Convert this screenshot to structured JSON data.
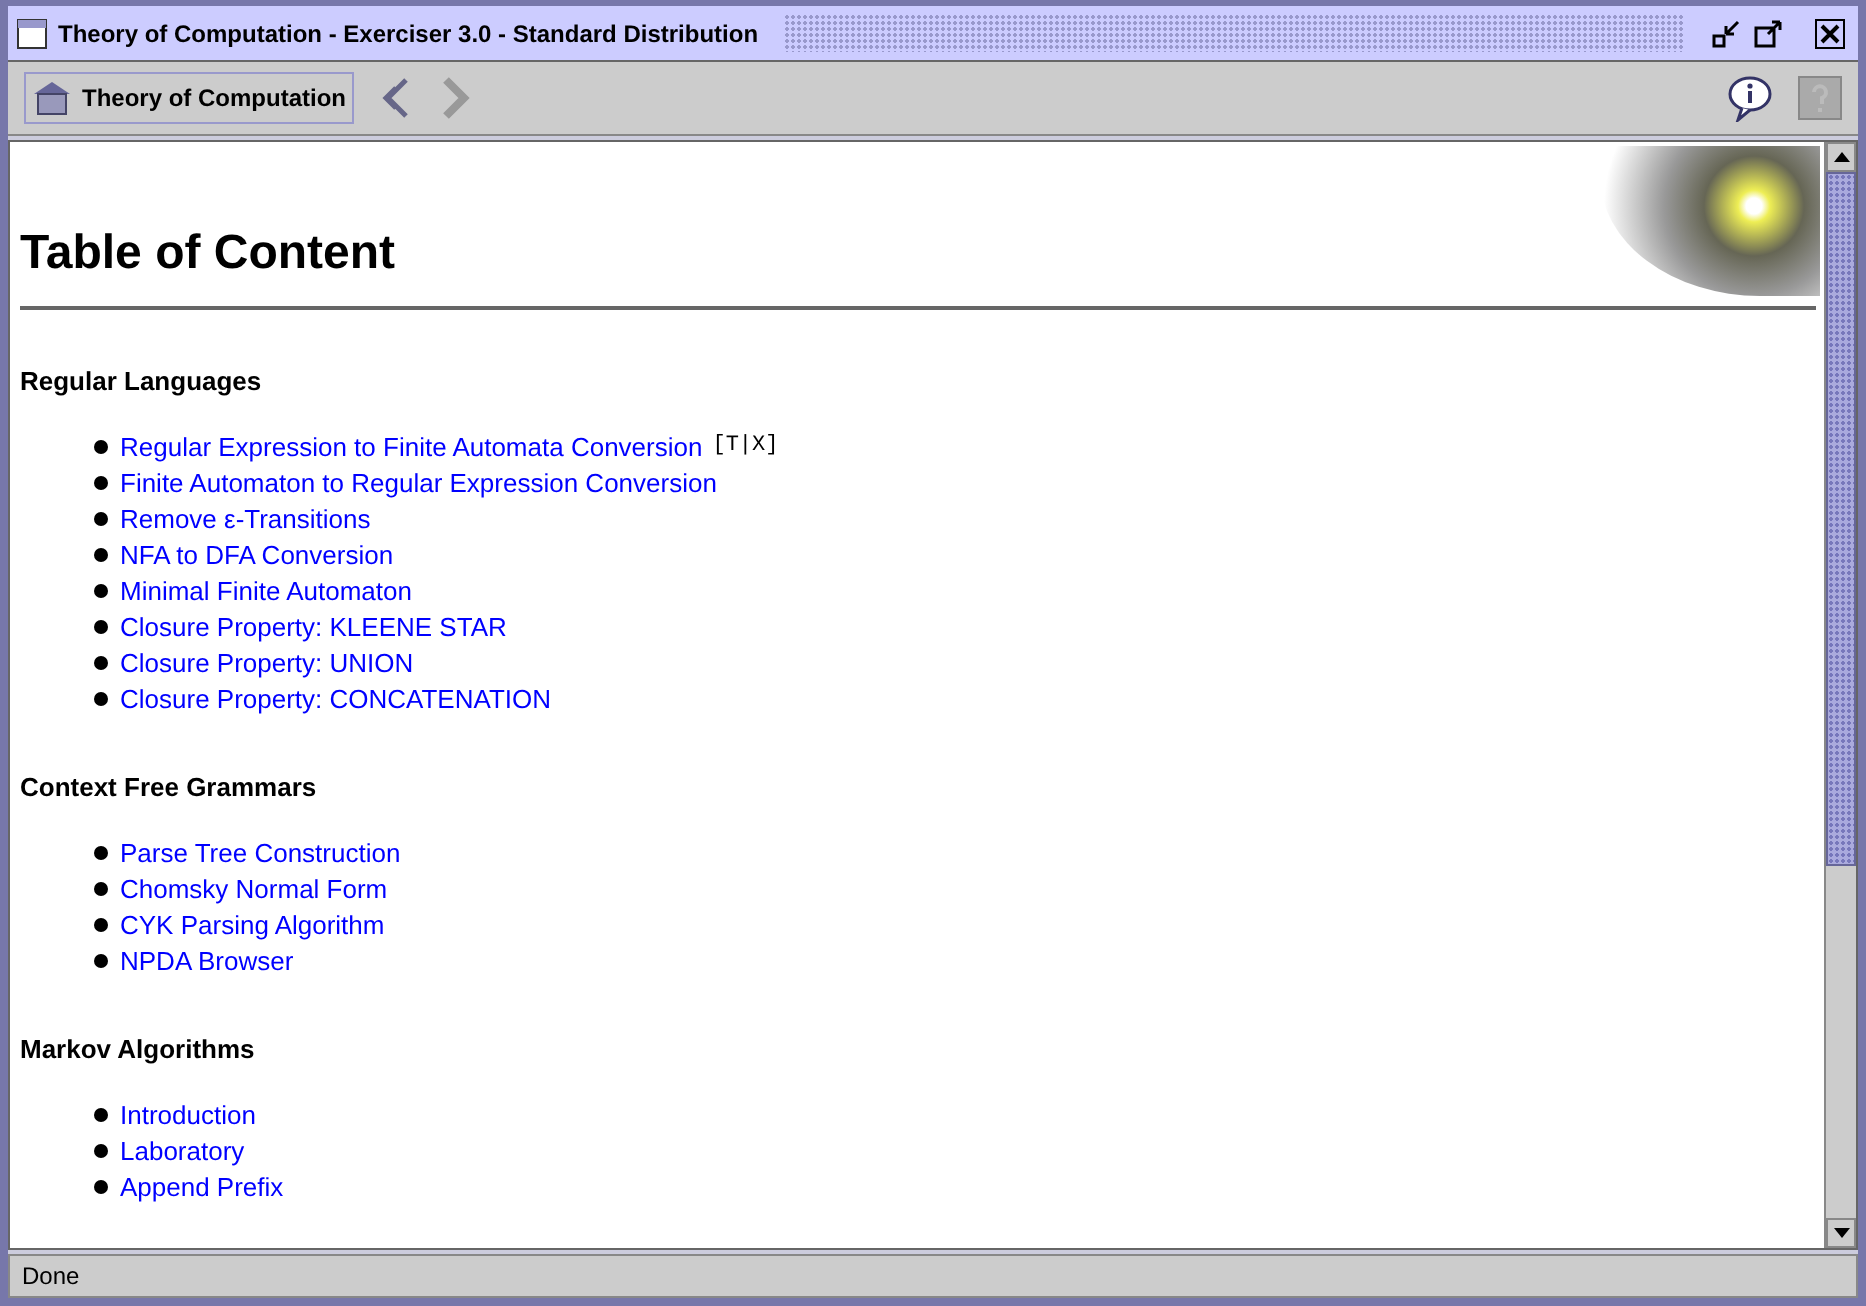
{
  "window": {
    "title": "Theory of Computation - Exerciser 3.0 - Standard Distribution"
  },
  "toolbar": {
    "home_button": "Theory of Computation",
    "back_enabled": true,
    "forward_enabled": false,
    "help_enabled": false
  },
  "page": {
    "title": "Table of Content",
    "sections": [
      {
        "heading": "Regular Languages",
        "links": [
          {
            "label": "Regular Expression to Finite Automata Conversion",
            "suffix": "[T|X]"
          },
          {
            "label": "Finite Automaton to Regular Expression Conversion"
          },
          {
            "label": "Remove ε-Transitions"
          },
          {
            "label": "NFA to DFA Conversion"
          },
          {
            "label": "Minimal Finite Automaton"
          },
          {
            "label": "Closure Property: KLEENE STAR"
          },
          {
            "label": "Closure Property: UNION"
          },
          {
            "label": "Closure Property: CONCATENATION"
          }
        ]
      },
      {
        "heading": "Context Free Grammars",
        "links": [
          {
            "label": "Parse Tree Construction"
          },
          {
            "label": "Chomsky Normal Form"
          },
          {
            "label": "CYK Parsing Algorithm"
          },
          {
            "label": "NPDA Browser"
          }
        ]
      },
      {
        "heading": "Markov Algorithms",
        "links": [
          {
            "label": "Introduction"
          },
          {
            "label": "Laboratory"
          },
          {
            "label": "Append Prefix"
          }
        ]
      }
    ]
  },
  "status_bar": "Done"
}
